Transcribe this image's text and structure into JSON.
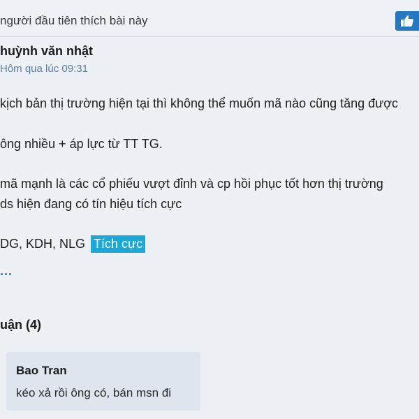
{
  "like_bar": {
    "text": "người đầu tiên thích bài này",
    "like_icon": "thumbs-up-icon"
  },
  "post": {
    "author": "huỳnh văn nhật",
    "timestamp": "Hôm qua lúc 09:31",
    "lines": [
      "kịch bản thị trường hiện tại thì không thể muốn mã nào cũng tăng được",
      "ông nhiều + áp lực từ TT TG.",
      "mã mạnh là các cổ phiếu vượt đỉnh và cp hồi phục tốt hơn thị trường",
      "ds hiện đang có tín hiệu tích cực",
      "DG, KDH, NLG"
    ],
    "tag": "Tích cực",
    "more": "..."
  },
  "comments": {
    "header": "uận (4)",
    "items": [
      {
        "author": "Bao Tran",
        "text": "kéo xả rồi ông có, bán msn đi"
      }
    ]
  },
  "colors": {
    "background": "#edf1f6",
    "accent": "#2577c2",
    "tag_bg": "#1aa8d8",
    "card_bg": "#dfe5ee"
  }
}
